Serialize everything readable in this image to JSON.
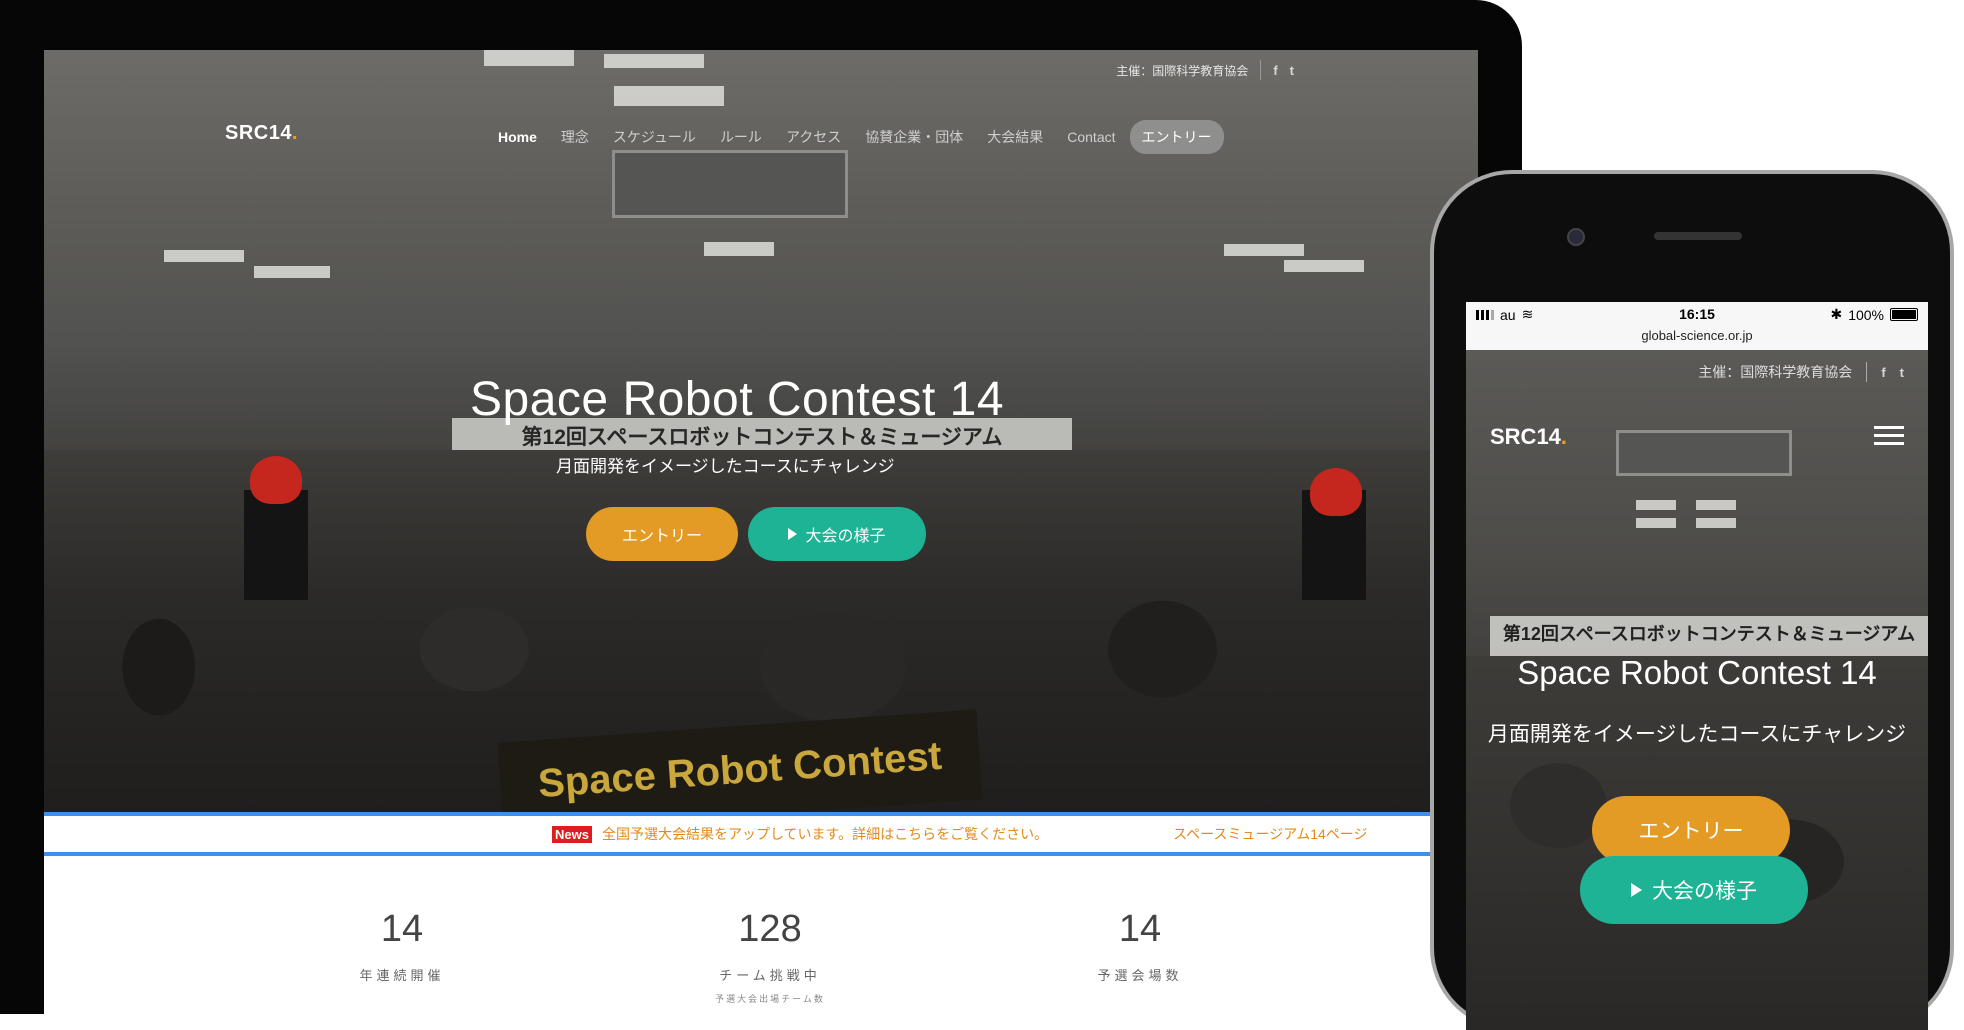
{
  "tablet": {
    "topbar": {
      "organizer": "主催：国際科学教育協会",
      "facebook_icon": "f",
      "twitter_icon": "t"
    },
    "logo": {
      "text": "SRC14",
      "dot": "."
    },
    "nav": {
      "items": [
        "Home",
        "理念",
        "スケジュール",
        "ルール",
        "アクセス",
        "協賛企業・団体",
        "大会結果",
        "Contact"
      ],
      "entry": "エントリー"
    },
    "hero": {
      "title": "Space Robot Contest 14",
      "subtitle": "月面開発をイメージしたコースにチャレンジ",
      "entry_button": "エントリー",
      "watch_button": "大会の様子",
      "photo_banner_text": "第12回スペースロボットコンテスト＆ミュージアム",
      "photo_banner_front": "Space Robot Contest"
    },
    "news": {
      "badge": "News",
      "text": "全国予選大会結果をアップしています。詳細はこちらをご覧ください。",
      "text2": "スペースミュージアム14ページ"
    },
    "stats": [
      {
        "value": "14",
        "label": "年連続開催",
        "sub": ""
      },
      {
        "value": "128",
        "label": "チーム挑戦中",
        "sub": "予選大会出場チーム数"
      },
      {
        "value": "14",
        "label": "予選会場数",
        "sub": ""
      }
    ]
  },
  "phone": {
    "status": {
      "carrier": "au",
      "time": "16:15",
      "battery": "100%"
    },
    "url": "global-science.or.jp",
    "topbar": {
      "organizer": "主催：国際科学教育協会",
      "facebook_icon": "f",
      "twitter_icon": "t"
    },
    "logo": {
      "text": "SRC14",
      "dot": "."
    },
    "photo_banner_text": "第12回スペースロボットコンテスト＆ミュージアム",
    "hero": {
      "title": "Space Robot Contest 14",
      "subtitle": "月面開発をイメージしたコースにチャレンジ",
      "entry_button": "エントリー",
      "watch_button": "大会の様子"
    }
  },
  "colors": {
    "accent_orange": "#e39b25",
    "accent_green": "#1db394",
    "news_border": "#3f8ef0",
    "news_badge": "#e11c1c"
  }
}
